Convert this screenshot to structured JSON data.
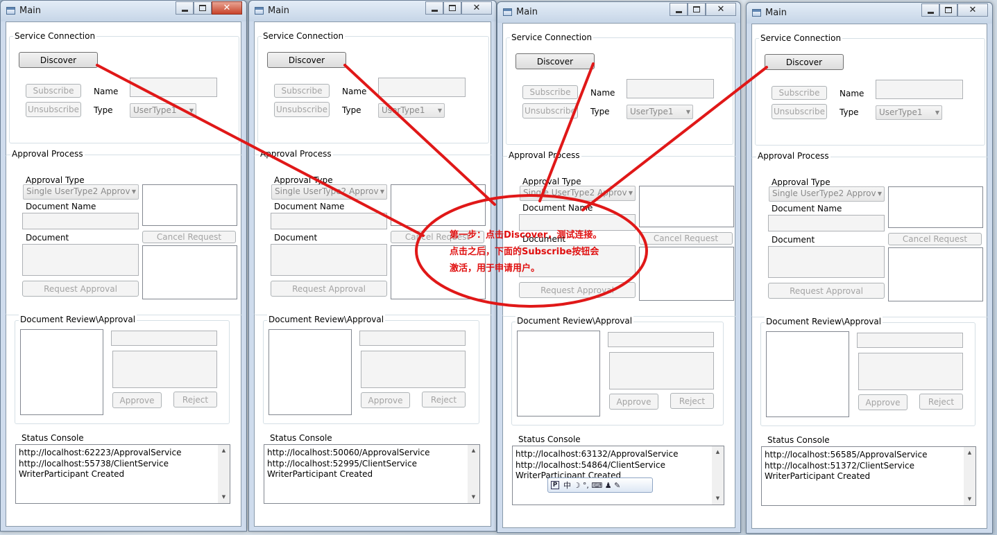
{
  "title": "Main",
  "labels": {
    "service_connection": "Service Connection",
    "discover": "Discover",
    "subscribe": "Subscribe",
    "unsubscribe": "Unsubscribe",
    "name": "Name",
    "type": "Type",
    "approval_process": "Approval Process",
    "approval_type": "Approval Type",
    "document_name": "Document Name",
    "document": "Document",
    "cancel_request": "Cancel Request",
    "request_approval": "Request Approval",
    "document_review": "Document Review\\Approval",
    "approve": "Approve",
    "reject": "Reject",
    "status_console": "Status Console"
  },
  "type_selected": "UserType1",
  "approval_type_selected": "Single UserType2 Approv",
  "windows": [
    {
      "console": [
        "http://localhost:62223/ApprovalService",
        "http://localhost:55738/ClientService",
        "WriterParticipant Created"
      ]
    },
    {
      "console": [
        "http://localhost:50060/ApprovalService",
        "http://localhost:52995/ClientService",
        "WriterParticipant Created"
      ]
    },
    {
      "console": [
        "http://localhost:63132/ApprovalService",
        "http://localhost:54864/ClientService",
        "WriterParticipant Created"
      ]
    },
    {
      "console": [
        "http://localhost:56585/ApprovalService",
        "http://localhost:51372/ClientService",
        "WriterParticipant Created"
      ]
    }
  ],
  "annotation": {
    "line1": "第一步：点击Discover，测试连接。",
    "line2": "点击之后，下面的Subscribe按钮会",
    "line3": "激活，用于申请用户。",
    "color": "#e01010"
  },
  "ime_toolbar": {
    "text": "中 ☽ °, ⌨ ♟ ✎"
  }
}
